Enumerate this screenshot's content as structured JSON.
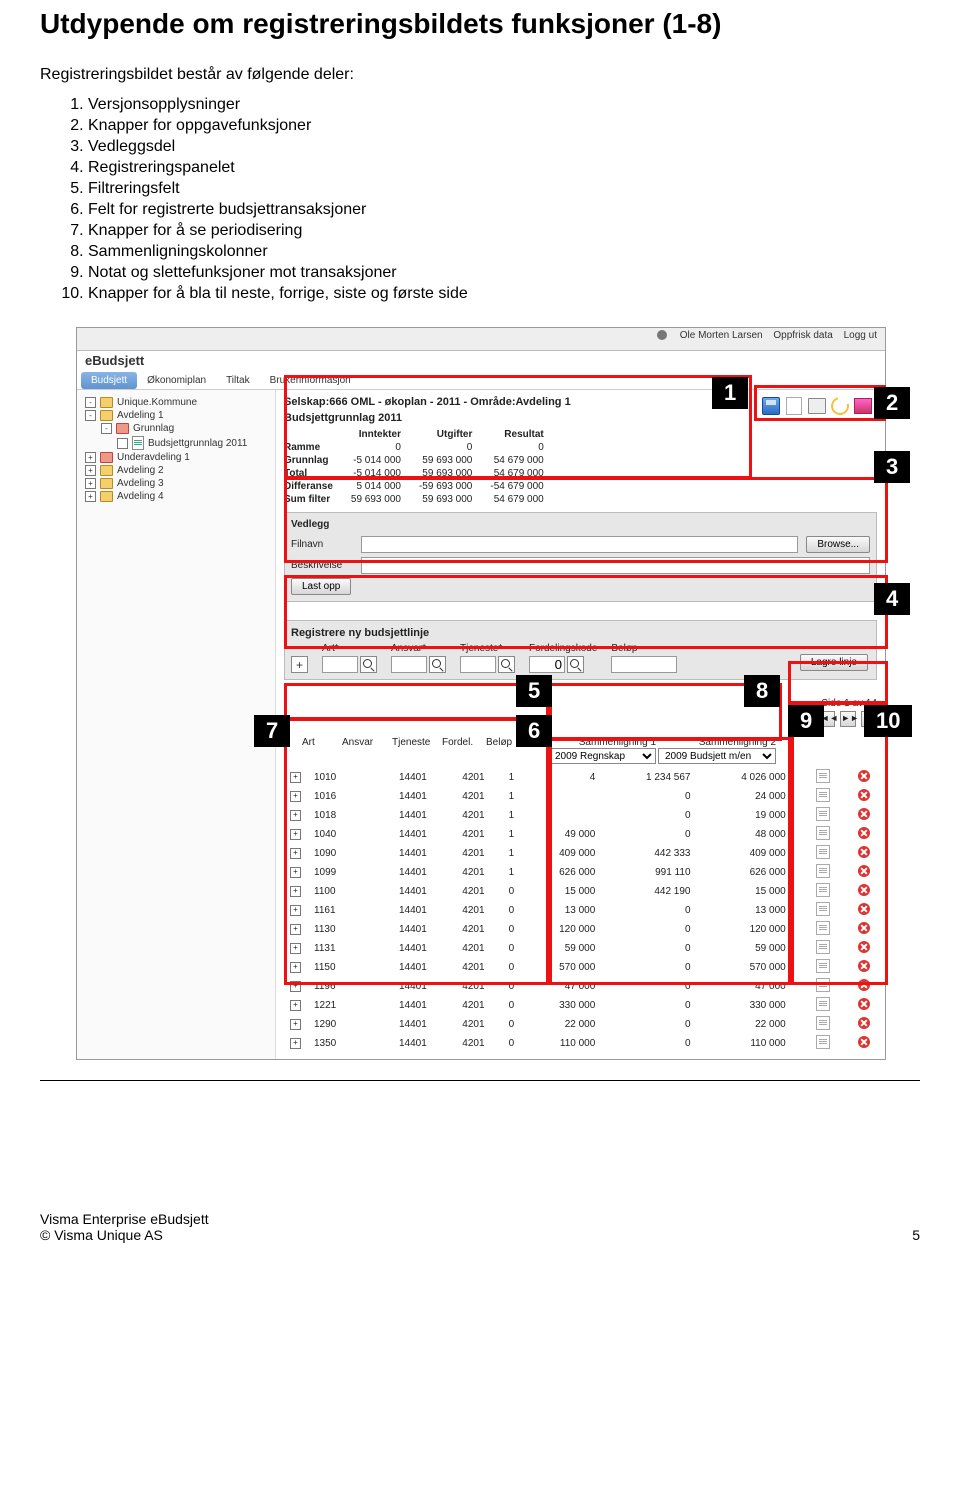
{
  "page_title": "Utdypende om registreringsbildets funksjoner (1-8)",
  "intro": "Registreringsbildet består av følgende deler:",
  "functions": [
    "Versjonsopplysninger",
    "Knapper for oppgavefunksjoner",
    "Vedleggsdel",
    "Registreringspanelet",
    "Filtreringsfelt",
    "Felt for registrerte budsjettransaksjoner",
    "Knapper for å se periodisering",
    "Sammenligningskolonner",
    "Notat og slettefunksjoner mot transaksjoner",
    "Knapper for å bla til neste, forrige, siste og første side"
  ],
  "topbar": {
    "user": "Ole Morten Larsen",
    "refresh": "Oppfrisk data",
    "logout": "Logg ut"
  },
  "brand": "eBudsjett",
  "maintabs": [
    "Budsjett",
    "Økonomiplan",
    "Tiltak",
    "Brukerinformasjon"
  ],
  "tree": {
    "root": "Unique.Kommune",
    "items": [
      {
        "level": 1,
        "sign": "-",
        "label": "Unique.Kommune"
      },
      {
        "level": 1,
        "sign": "-",
        "label": "Avdeling 1"
      },
      {
        "level": 2,
        "sign": "-",
        "label": "Grunnlag",
        "red": true
      },
      {
        "level": 3,
        "sign": "",
        "label": "Budsjettgrunnlag 2011",
        "xls": true
      },
      {
        "level": 1,
        "sign": "+",
        "label": "Underavdeling 1",
        "red": true
      },
      {
        "level": 1,
        "sign": "+",
        "label": "Avdeling 2"
      },
      {
        "level": 1,
        "sign": "+",
        "label": "Avdeling 3"
      },
      {
        "level": 1,
        "sign": "+",
        "label": "Avdeling 4"
      }
    ]
  },
  "context": {
    "path": "Selskap:666 OML - økoplan - 2011 - Område:Avdeling 1",
    "subtitle": "Budsjettgrunnlag 2011"
  },
  "summary": {
    "headers": [
      "",
      "Inntekter",
      "Utgifter",
      "Resultat"
    ],
    "rows": [
      [
        "Ramme",
        "0",
        "0",
        "0"
      ],
      [
        "Grunnlag",
        "-5 014 000",
        "59 693 000",
        "54 679 000"
      ],
      [
        "Total",
        "-5 014 000",
        "59 693 000",
        "54 679 000"
      ],
      [
        "Differanse",
        "5 014 000",
        "-59 693 000",
        "-54 679 000"
      ],
      [
        "Sum filter",
        "59 693 000",
        "59 693 000",
        "54 679 000"
      ]
    ]
  },
  "vedlegg": {
    "title": "Vedlegg",
    "filnavn": "Filnavn",
    "beskrivelse": "Beskrivelse",
    "browse": "Browse...",
    "upload": "Last opp"
  },
  "register": {
    "title": "Registrere ny budsjettlinje",
    "cols": [
      "Art*",
      "Ansvar*",
      "Tjeneste*",
      "Fordelingskode",
      "Beløp"
    ],
    "lagre": "Lagre linje",
    "zero": "0"
  },
  "pager": {
    "label": "Side 1 av 14",
    "first": "|◄",
    "prev": "◄◄",
    "next": "►►",
    "last": "►|"
  },
  "dataheaders": [
    "Art",
    "Ansvar",
    "Tjeneste",
    "Fordel.",
    "Beløp"
  ],
  "comparison": {
    "label1": "Sammenligning 1",
    "label2": "Sammenligning 2",
    "opt1": "2009 Regnskap",
    "opt2": "2009 Budsjett m/en"
  },
  "rows": [
    {
      "art": "1010",
      "ansvar": "14401",
      "tj": "4201",
      "f": "1",
      "belop": "4",
      "c1": "1 234 567",
      "c2": "4 026 000"
    },
    {
      "art": "1016",
      "ansvar": "14401",
      "tj": "4201",
      "f": "1",
      "belop": "",
      "c1": "0",
      "c2": "24 000"
    },
    {
      "art": "1018",
      "ansvar": "14401",
      "tj": "4201",
      "f": "1",
      "belop": "",
      "c1": "0",
      "c2": "19 000"
    },
    {
      "art": "1040",
      "ansvar": "14401",
      "tj": "4201",
      "f": "1",
      "belop": "49 000",
      "c1": "0",
      "c2": "48 000"
    },
    {
      "art": "1090",
      "ansvar": "14401",
      "tj": "4201",
      "f": "1",
      "belop": "409 000",
      "c1": "442 333",
      "c2": "409 000"
    },
    {
      "art": "1099",
      "ansvar": "14401",
      "tj": "4201",
      "f": "1",
      "belop": "626 000",
      "c1": "991 110",
      "c2": "626 000"
    },
    {
      "art": "1100",
      "ansvar": "14401",
      "tj": "4201",
      "f": "0",
      "belop": "15 000",
      "c1": "442 190",
      "c2": "15 000"
    },
    {
      "art": "1161",
      "ansvar": "14401",
      "tj": "4201",
      "f": "0",
      "belop": "13 000",
      "c1": "0",
      "c2": "13 000"
    },
    {
      "art": "1130",
      "ansvar": "14401",
      "tj": "4201",
      "f": "0",
      "belop": "120 000",
      "c1": "0",
      "c2": "120 000"
    },
    {
      "art": "1131",
      "ansvar": "14401",
      "tj": "4201",
      "f": "0",
      "belop": "59 000",
      "c1": "0",
      "c2": "59 000"
    },
    {
      "art": "1150",
      "ansvar": "14401",
      "tj": "4201",
      "f": "0",
      "belop": "570 000",
      "c1": "0",
      "c2": "570 000"
    },
    {
      "art": "1196",
      "ansvar": "14401",
      "tj": "4201",
      "f": "0",
      "belop": "47 000",
      "c1": "0",
      "c2": "47 000"
    },
    {
      "art": "1221",
      "ansvar": "14401",
      "tj": "4201",
      "f": "0",
      "belop": "330 000",
      "c1": "0",
      "c2": "330 000"
    },
    {
      "art": "1290",
      "ansvar": "14401",
      "tj": "4201",
      "f": "0",
      "belop": "22 000",
      "c1": "0",
      "c2": "22 000"
    },
    {
      "art": "1350",
      "ansvar": "14401",
      "tj": "4201",
      "f": "0",
      "belop": "110 000",
      "c1": "0",
      "c2": "110 000"
    }
  ],
  "labels": {
    "1": "1",
    "2": "2",
    "3": "3",
    "4": "4",
    "5": "5",
    "6": "6",
    "7": "7",
    "8": "8",
    "9": "9",
    "10": "10"
  },
  "footer": {
    "line1": "Visma Enterprise eBudsjett",
    "line2": "© Visma Unique AS",
    "pagenum": "5"
  }
}
